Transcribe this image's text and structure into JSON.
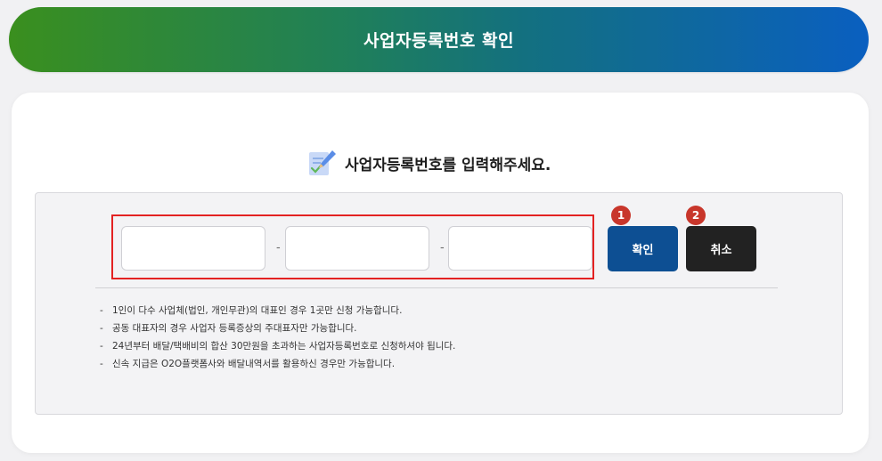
{
  "header": {
    "title": "사업자등록번호 확인"
  },
  "prompt": {
    "text": "사업자등록번호를 입력해주세요."
  },
  "form": {
    "inputs": [
      {
        "value": "",
        "placeholder": ""
      },
      {
        "value": "",
        "placeholder": ""
      },
      {
        "value": "",
        "placeholder": ""
      }
    ],
    "separator": "-",
    "confirm_label": "확인",
    "cancel_label": "취소",
    "badges": [
      "1",
      "2"
    ]
  },
  "notices": [
    "1인이 다수 사업체(법인, 개인무관)의 대표인 경우 1곳만 신청 가능합니다.",
    "공동 대표자의 경우 사업자 등록증상의 주대표자만 가능합니다.",
    "24년부터 배달/택배비의 합산 30만원을 초과하는 사업자등록번호로 신청하셔야 됩니다.",
    "신속 지급은 O2O플랫폼사와 배달내역서를 활용하신 경우만 가능합니다."
  ],
  "colors": {
    "header_gradient_start": "#3a8f1e",
    "header_gradient_end": "#0a5fc0",
    "confirm_button": "#0d4f93",
    "cancel_button": "#222222",
    "highlight_border": "#e32222",
    "badge": "#c8362b"
  },
  "icons": {
    "prompt_icon": "pencil-document-icon"
  }
}
